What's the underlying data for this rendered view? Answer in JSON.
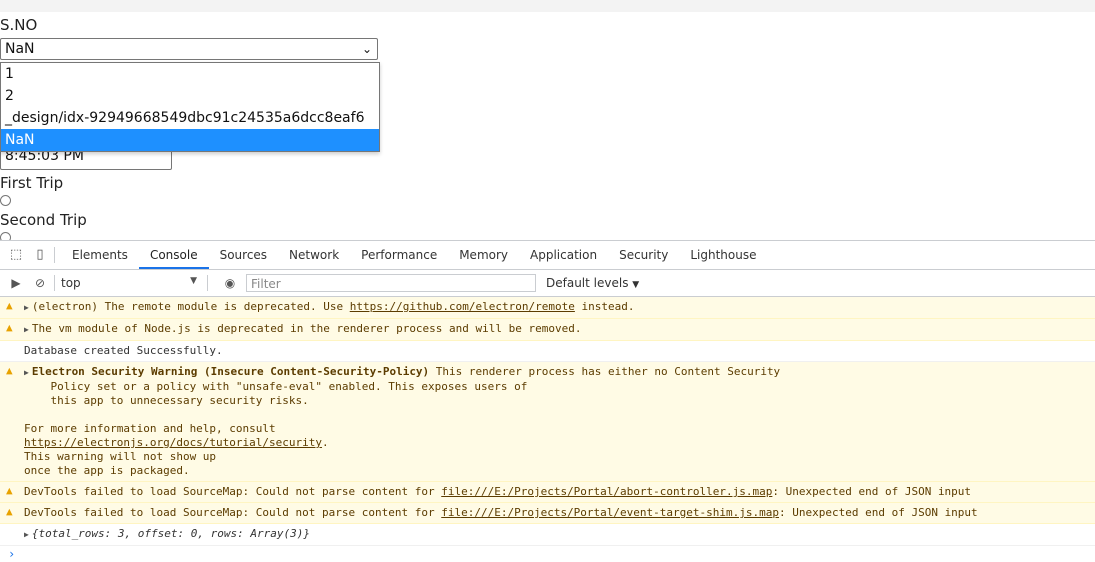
{
  "app": {
    "sno_label": "S.NO",
    "select_value": "NaN",
    "options": [
      "1",
      "2",
      "_design/idx-92949668549dbc91c24535a6dcc8eaf6",
      "NaN"
    ],
    "time_value": "8:45:03 PM",
    "first_trip_label": "First Trip",
    "second_trip_label": "Second Trip"
  },
  "devtools": {
    "tabs": [
      "Elements",
      "Console",
      "Sources",
      "Network",
      "Performance",
      "Memory",
      "Application",
      "Security",
      "Lighthouse"
    ],
    "active_tab": "Console",
    "context": "top",
    "filter_placeholder": "Filter",
    "levels_label": "Default levels",
    "messages": [
      {
        "type": "warn",
        "text": "(electron) The remote module is deprecated. Use ",
        "link": "https://github.com/electron/remote",
        "suffix": " instead."
      },
      {
        "type": "warn",
        "text": "The vm module of Node.js is deprecated in the renderer process and will be removed."
      },
      {
        "type": "log",
        "text": "Database created Successfully."
      },
      {
        "type": "warn",
        "bold": "Electron Security Warning (Insecure Content-Security-Policy)",
        "text": " This renderer process has either no Content Security\n    Policy set or a policy with \"unsafe-eval\" enabled. This exposes users of\n    this app to unnecessary security risks.\n\nFor more information and help, consult",
        "link": "https://electronjs.org/docs/tutorial/security",
        "suffix": ".\nThis warning will not show up\nonce the app is packaged."
      },
      {
        "type": "warn",
        "text": "DevTools failed to load SourceMap: Could not parse content for ",
        "link": "file:///E:/Projects/Portal/abort-controller.js.map",
        "suffix": ": Unexpected end of JSON input"
      },
      {
        "type": "warn",
        "text": "DevTools failed to load SourceMap: Could not parse content for ",
        "link": "file:///E:/Projects/Portal/event-target-shim.js.map",
        "suffix": ": Unexpected end of JSON input"
      },
      {
        "type": "log",
        "object": "{total_rows: 3, offset: 0, rows: Array(3)}"
      }
    ],
    "prompt": "›"
  },
  "colors": {
    "accent": "#1a73e8",
    "warn_bg": "#fffbe5",
    "option_selected": "#1e90ff"
  }
}
